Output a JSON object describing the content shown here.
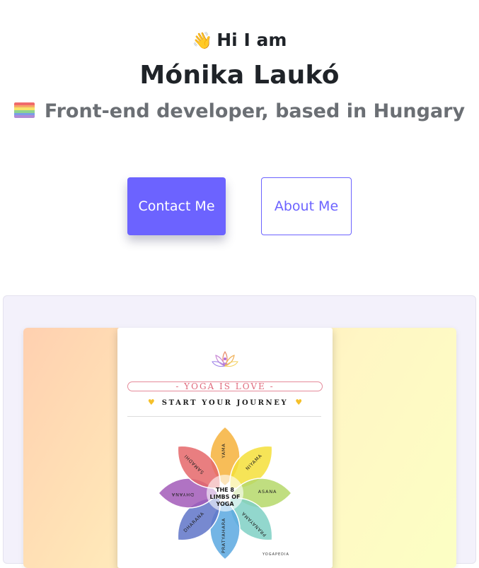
{
  "hero": {
    "wave_emoji": "👋",
    "greeting": "Hi I am",
    "name": "Mónika Laukó",
    "role": "Front-end developer, based in Hungary"
  },
  "buttons": {
    "contact_label": "Contact Me",
    "about_label": "About Me"
  },
  "project_card": {
    "badge": "- YOGA IS LOVE -",
    "subtitle": "START YOUR JOURNEY",
    "center_title_line1": "THE 8",
    "center_title_line2": "LIMBS OF",
    "center_title_line3": "YOGA",
    "limbs": [
      "YAMA",
      "NIYAMA",
      "ASANA",
      "PRANAYAMA",
      "PRATYAHARA",
      "DHARANA",
      "DHYANA",
      "SAMADHI"
    ],
    "brand": "YOGAPEDIA"
  },
  "colors": {
    "accent": "#6c63ff",
    "pride_flag": [
      "#e40303",
      "#ff8c00",
      "#ffed00",
      "#008026",
      "#24408e",
      "#732982"
    ]
  }
}
